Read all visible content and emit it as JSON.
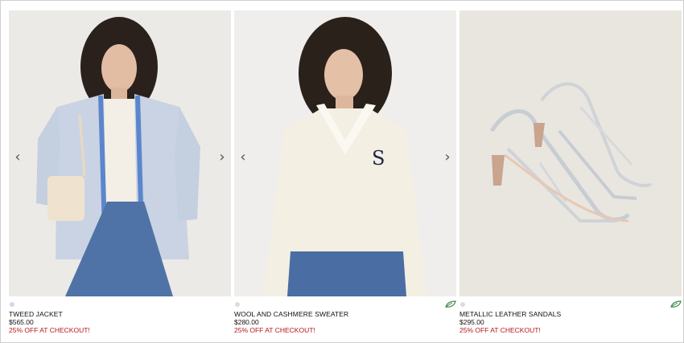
{
  "products": [
    {
      "name": "TWEED JACKET",
      "price": "$565.00",
      "promo": "25% OFF AT CHECKOUT!",
      "swatch_color": "#d9d4ea",
      "image_alt": "Model wearing blue tweed jacket and jeans with quilted bag"
    },
    {
      "name": "WOOL AND CASHMERE SWEATER",
      "price": "$280.00",
      "promo": "25% OFF AT CHECKOUT!",
      "swatch_color": "#dcdcdc",
      "eco_icon": "eco-leaf-icon",
      "image_alt": "Model wearing cream V-neck sweater with S logo"
    },
    {
      "name": "METALLIC LEATHER SANDALS",
      "price": "$295.00",
      "promo": "25% OFF AT CHECKOUT!",
      "swatch_color": "#dcdcdc",
      "eco_icon": "eco-leaf-icon",
      "image_alt": "Silver metallic strappy heeled sandals"
    }
  ],
  "carousel": {
    "prev_glyph": "‹",
    "next_glyph": "›"
  },
  "colors": {
    "promo": "#b5171b",
    "eco_green": "#3c8a4b"
  }
}
